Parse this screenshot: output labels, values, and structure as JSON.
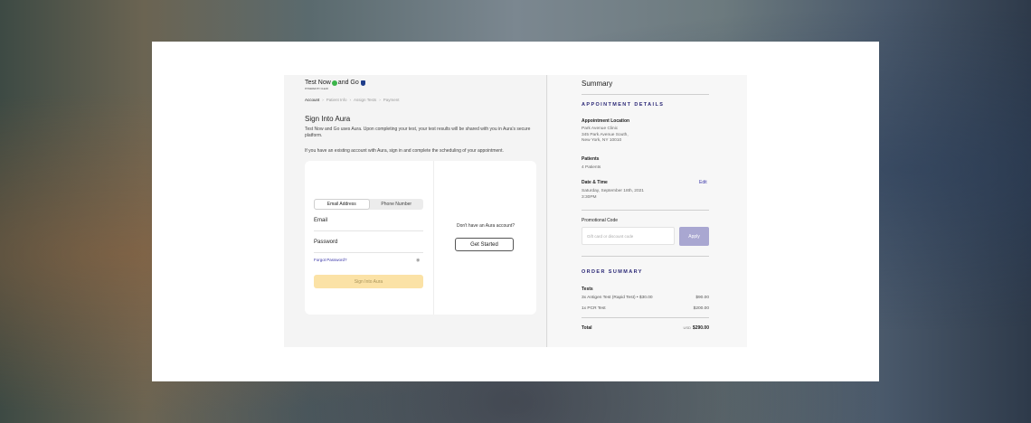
{
  "brand": {
    "name_part1": "Test Now",
    "name_part2": "and Go",
    "powered": "POWERED BY CLEAR"
  },
  "breadcrumb": [
    "Account",
    "Patient Info",
    "Assign Tests",
    "Payment"
  ],
  "signin": {
    "heading": "Sign Into Aura",
    "intro": "Test Now and Go uses Aura. Upon completing your test, your test results will be shared with you in Aura's secure platform.",
    "intro2": "If you have an existing account with Aura, sign in and complete the scheduling of your appointment.",
    "tabs": [
      "Email Address",
      "Phone Number"
    ],
    "email_label": "Email",
    "password_label": "Password",
    "forgot": "Forgot Password?",
    "eye_icon": "eye-icon",
    "signin_button": "Sign Into Aura",
    "no_account": "Don't have an Aura account?",
    "get_started": "Get Started"
  },
  "summary": {
    "title": "Summary",
    "appointment_title": "APPOINTMENT DETAILS",
    "location_label": "Appointment Location",
    "location_lines": [
      "Park Avenue Clinic",
      "345 Park Avenue South,",
      "New York, NY 10010"
    ],
    "patients_label": "Patients",
    "patients_value": "4 Patients",
    "datetime_label": "Date & Time",
    "edit": "Edit",
    "datetime_lines": [
      "Saturday, September 18th, 2021",
      "3:30PM"
    ],
    "promo_label": "Promotional Code",
    "promo_placeholder": "Gift card or discount code",
    "apply": "Apply",
    "order_title": "ORDER SUMMARY",
    "tests_label": "Tests",
    "items": [
      {
        "name": "3x Antigen Test (Rapid Test) • $30.00",
        "price": "$90.00"
      },
      {
        "name": "1x PCR Test",
        "price": "$200.00"
      }
    ],
    "total_label": "Total",
    "currency": "USD",
    "total": "$290.00"
  },
  "colors": {
    "accent": "#3a36a8",
    "section_title": "#2b2876",
    "signin_button": "#fbe2a6",
    "apply_button": "#a9a7d1"
  }
}
